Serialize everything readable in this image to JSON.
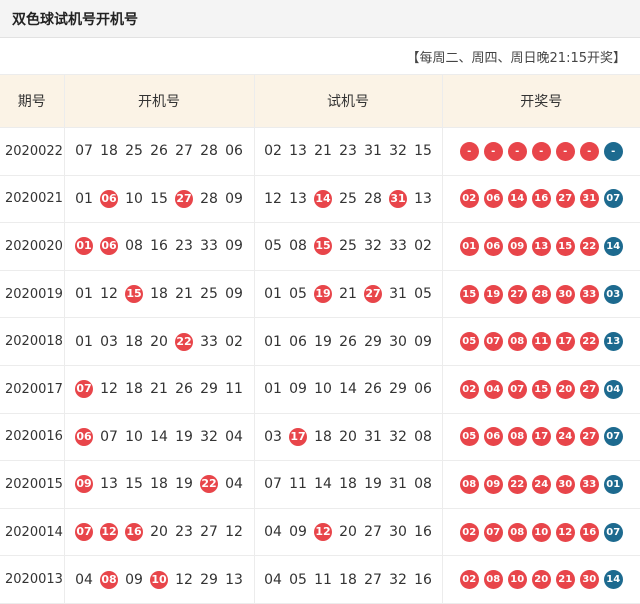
{
  "header": {
    "title": "双色球试机号开机号"
  },
  "schedule": "【每周二、周四、周日晚21:15开奖】",
  "colors": {
    "red": "#e8454a",
    "blue": "#1d6a8f",
    "header_bg": "#fbf3e6"
  },
  "columns": [
    "期号",
    "开机号",
    "试机号",
    "开奖号"
  ],
  "rows": [
    {
      "period": "2020022",
      "open": [
        "07",
        "18",
        "25",
        "26",
        "27",
        "28",
        "06"
      ],
      "open_hl": [],
      "trial": [
        "02",
        "13",
        "21",
        "23",
        "31",
        "32",
        "15"
      ],
      "trial_hl": [],
      "draw": [
        "-",
        "-",
        "-",
        "-",
        "-",
        "-"
      ],
      "draw_blue": "-"
    },
    {
      "period": "2020021",
      "open": [
        "01",
        "06",
        "10",
        "15",
        "27",
        "28",
        "09"
      ],
      "open_hl": [
        1,
        4
      ],
      "trial": [
        "12",
        "13",
        "14",
        "25",
        "28",
        "31",
        "13"
      ],
      "trial_hl": [
        2,
        5
      ],
      "draw": [
        "02",
        "06",
        "14",
        "16",
        "27",
        "31"
      ],
      "draw_blue": "07"
    },
    {
      "period": "2020020",
      "open": [
        "01",
        "06",
        "08",
        "16",
        "23",
        "33",
        "09"
      ],
      "open_hl": [
        0,
        1
      ],
      "trial": [
        "05",
        "08",
        "15",
        "25",
        "32",
        "33",
        "02"
      ],
      "trial_hl": [
        2
      ],
      "draw": [
        "01",
        "06",
        "09",
        "13",
        "15",
        "22"
      ],
      "draw_blue": "14"
    },
    {
      "period": "2020019",
      "open": [
        "01",
        "12",
        "15",
        "18",
        "21",
        "25",
        "09"
      ],
      "open_hl": [
        2
      ],
      "trial": [
        "01",
        "05",
        "19",
        "21",
        "27",
        "31",
        "05"
      ],
      "trial_hl": [
        2,
        4
      ],
      "draw": [
        "15",
        "19",
        "27",
        "28",
        "30",
        "33"
      ],
      "draw_blue": "03"
    },
    {
      "period": "2020018",
      "open": [
        "01",
        "03",
        "18",
        "20",
        "22",
        "33",
        "02"
      ],
      "open_hl": [
        4
      ],
      "trial": [
        "01",
        "06",
        "19",
        "26",
        "29",
        "30",
        "09"
      ],
      "trial_hl": [],
      "draw": [
        "05",
        "07",
        "08",
        "11",
        "17",
        "22"
      ],
      "draw_blue": "13"
    },
    {
      "period": "2020017",
      "open": [
        "07",
        "12",
        "18",
        "21",
        "26",
        "29",
        "11"
      ],
      "open_hl": [
        0
      ],
      "trial": [
        "01",
        "09",
        "10",
        "14",
        "26",
        "29",
        "06"
      ],
      "trial_hl": [],
      "draw": [
        "02",
        "04",
        "07",
        "15",
        "20",
        "27"
      ],
      "draw_blue": "04"
    },
    {
      "period": "2020016",
      "open": [
        "06",
        "07",
        "10",
        "14",
        "19",
        "32",
        "04"
      ],
      "open_hl": [
        0
      ],
      "trial": [
        "03",
        "17",
        "18",
        "20",
        "31",
        "32",
        "08"
      ],
      "trial_hl": [
        1
      ],
      "draw": [
        "05",
        "06",
        "08",
        "17",
        "24",
        "27"
      ],
      "draw_blue": "07"
    },
    {
      "period": "2020015",
      "open": [
        "09",
        "13",
        "15",
        "18",
        "19",
        "22",
        "04"
      ],
      "open_hl": [
        0,
        5
      ],
      "trial": [
        "07",
        "11",
        "14",
        "18",
        "19",
        "31",
        "08"
      ],
      "trial_hl": [],
      "draw": [
        "08",
        "09",
        "22",
        "24",
        "30",
        "33"
      ],
      "draw_blue": "01"
    },
    {
      "period": "2020014",
      "open": [
        "07",
        "12",
        "16",
        "20",
        "23",
        "27",
        "12"
      ],
      "open_hl": [
        0,
        1,
        2
      ],
      "trial": [
        "04",
        "09",
        "12",
        "20",
        "27",
        "30",
        "16"
      ],
      "trial_hl": [
        2
      ],
      "draw": [
        "02",
        "07",
        "08",
        "10",
        "12",
        "16"
      ],
      "draw_blue": "07"
    },
    {
      "period": "2020013",
      "open": [
        "04",
        "08",
        "09",
        "10",
        "12",
        "29",
        "13"
      ],
      "open_hl": [
        1,
        3
      ],
      "trial": [
        "04",
        "05",
        "11",
        "18",
        "27",
        "32",
        "16"
      ],
      "trial_hl": [],
      "draw": [
        "02",
        "08",
        "10",
        "20",
        "21",
        "30"
      ],
      "draw_blue": "14"
    }
  ]
}
